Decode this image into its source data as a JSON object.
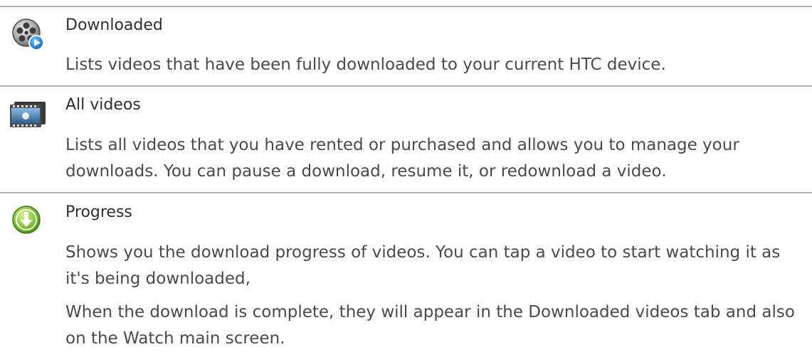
{
  "sections": [
    {
      "icon": "film-reel-play-icon",
      "title": "Downloaded",
      "paragraphs": [
        "Lists videos that have been fully downloaded to your current HTC device."
      ]
    },
    {
      "icon": "film-strip-icon",
      "title": "All videos",
      "paragraphs": [
        "Lists all videos that you have rented or purchased and allows you to manage your downloads. You can pause a download, resume it, or redownload a video."
      ]
    },
    {
      "icon": "download-arrow-icon",
      "title": "Progress",
      "paragraphs": [
        "Shows you the download progress of videos. You can tap a video to start watching it as it's being downloaded,",
        "When the download is complete, they will appear in the Downloaded videos tab and also on the Watch main screen."
      ]
    }
  ]
}
